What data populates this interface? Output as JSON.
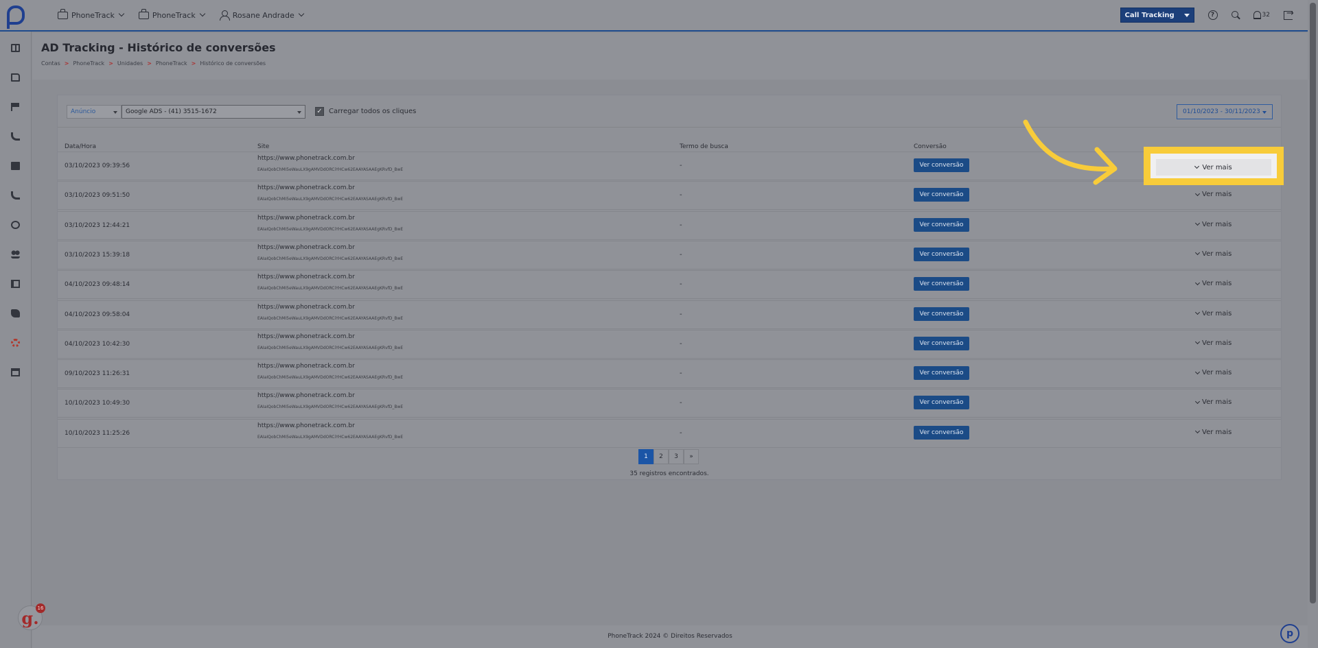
{
  "topbar": {
    "nav": [
      {
        "label": "PhoneTrack",
        "icon": "briefcase-icon"
      },
      {
        "label": "PhoneTrack",
        "icon": "briefcase-icon"
      },
      {
        "label": "Rosane Andrade",
        "icon": "user-icon"
      }
    ],
    "product_select": "Call Tracking",
    "notifications_count": "32"
  },
  "page": {
    "title": "AD Tracking - Histórico de conversões",
    "breadcrumb": [
      "Contas",
      "PhoneTrack",
      "Unidades",
      "PhoneTrack",
      "Histórico de conversões"
    ],
    "breadcrumb_sep": ">"
  },
  "filters": {
    "type_select": "Anúncio",
    "ad_select": "Google ADS - (41) 3515-1672",
    "load_all_label": "Carregar todos os cliques",
    "load_all_checked": true,
    "date_range": "01/10/2023 - 30/11/2023"
  },
  "table": {
    "headers": [
      "Data/Hora",
      "Site",
      "Termo de busca",
      "Conversão"
    ],
    "button_label": "Ver conversão",
    "more_label": "Ver mais",
    "rows": [
      {
        "date": "03/10/2023 09:39:56",
        "site": "https://www.phonetrack.com.br",
        "gclid": "EAIaIQobChMI5eWauLX9gAMVDdORCiYHCw62EAAYASAAEgKRvfD_BwE",
        "term": "-"
      },
      {
        "date": "03/10/2023 09:51:50",
        "site": "https://www.phonetrack.com.br",
        "gclid": "EAIaIQobChMI5eWauLX9gAMVDdORCiYHCw62EAAYASAAEgKRvfD_BwE",
        "term": "-"
      },
      {
        "date": "03/10/2023 12:44:21",
        "site": "https://www.phonetrack.com.br",
        "gclid": "EAIaIQobChMI5eWauLX9gAMVDdORCiYHCw62EAAYASAAEgKRvfD_BwE",
        "term": "-"
      },
      {
        "date": "03/10/2023 15:39:18",
        "site": "https://www.phonetrack.com.br",
        "gclid": "EAIaIQobChMI5eWauLX9gAMVDdORCiYHCw62EAAYASAAEgKRvfD_BwE",
        "term": "-"
      },
      {
        "date": "04/10/2023 09:48:14",
        "site": "https://www.phonetrack.com.br",
        "gclid": "EAIaIQobChMI5eWauLX9gAMVDdORCiYHCw62EAAYASAAEgKRvfD_BwE",
        "term": "-"
      },
      {
        "date": "04/10/2023 09:58:04",
        "site": "https://www.phonetrack.com.br",
        "gclid": "EAIaIQobChMI5eWauLX9gAMVDdORCiYHCw62EAAYASAAEgKRvfD_BwE",
        "term": "-"
      },
      {
        "date": "04/10/2023 10:42:30",
        "site": "https://www.phonetrack.com.br",
        "gclid": "EAIaIQobChMI5eWauLX9gAMVDdORCiYHCw62EAAYASAAEgKRvfD_BwE",
        "term": "-"
      },
      {
        "date": "09/10/2023 11:26:31",
        "site": "https://www.phonetrack.com.br",
        "gclid": "EAIaIQobChMI5eWauLX9gAMVDdORCiYHCw62EAAYASAAEgKRvfD_BwE",
        "term": "-"
      },
      {
        "date": "10/10/2023 10:49:30",
        "site": "https://www.phonetrack.com.br",
        "gclid": "EAIaIQobChMI5eWauLX9gAMVDdORCiYHCw62EAAYASAAEgKRvfD_BwE",
        "term": "-"
      },
      {
        "date": "10/10/2023 11:25:26",
        "site": "https://www.phonetrack.com.br",
        "gclid": "EAIaIQobChMI5eWauLX9gAMVDdORCiYHCw62EAAYASAAEgKRvfD_BwE",
        "term": "-"
      }
    ]
  },
  "pagination": {
    "pages": [
      "1",
      "2",
      "3",
      "»"
    ],
    "active": "1",
    "records": "35 registros encontrados."
  },
  "footer": "PhoneTrack 2024 © Direitos Reservados",
  "widget": {
    "letter": "g.",
    "count": "16"
  },
  "help_bubble": "p",
  "colors": {
    "accent": "#1b4b86",
    "highlight": "#f8cc3a",
    "danger": "#a22a2a"
  },
  "sidebar_icons": [
    "dashboard-icon",
    "document-icon",
    "flag-icon",
    "phone-icon",
    "contact-card-icon",
    "phone-outgoing-icon",
    "circle-icon",
    "users-icon",
    "book-icon",
    "puzzle-icon",
    "gear-icon",
    "store-icon"
  ]
}
